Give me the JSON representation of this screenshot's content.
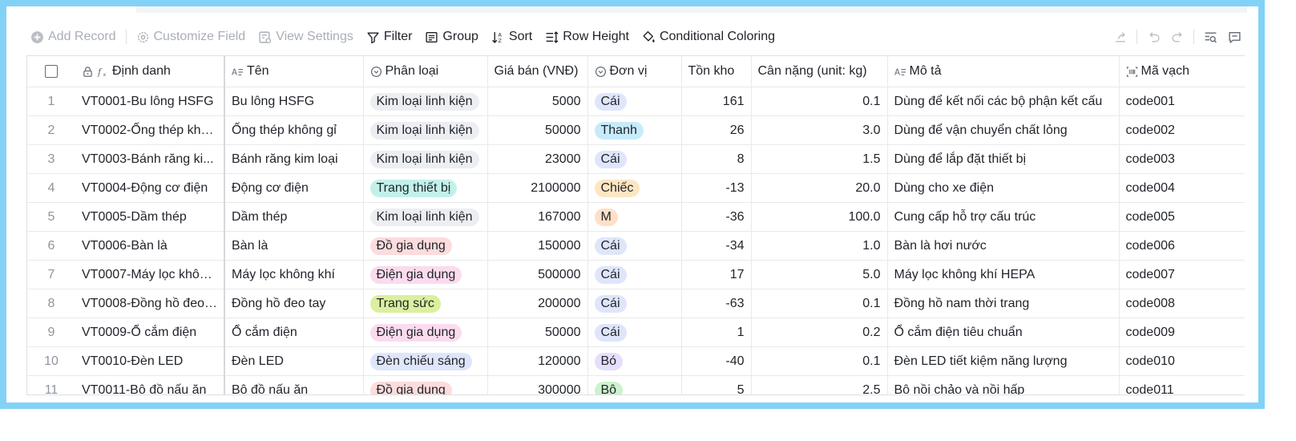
{
  "toolbar": {
    "add_record": "Add Record",
    "customize_field": "Customize Field",
    "view_settings": "View Settings",
    "filter": "Filter",
    "group": "Group",
    "sort": "Sort",
    "row_height": "Row Height",
    "conditional_coloring": "Conditional Coloring"
  },
  "columns": {
    "id": "Định danh",
    "name": "Tên",
    "category": "Phân loại",
    "price": "Giá bán (VNĐ)",
    "unit": "Đơn vị",
    "stock": "Tồn kho",
    "weight": "Cân nặng (unit: kg)",
    "desc": "Mô tả",
    "barcode": "Mã vạch"
  },
  "tag_colors": {
    "Kim loại linh kiện": "#eceef1",
    "Trang thiết bị": "#c2f1ea",
    "Đồ gia dụng": "#fcdcdc",
    "Điện gia dụng": "#fbdbee",
    "Trang sức": "#dbef9e",
    "Đèn chiếu sáng": "#dfe6fb",
    "Cái": "#dfe6fb",
    "Thanh": "#c8ebfa",
    "Chiếc": "#fde6c2",
    "M": "#fde0c8",
    "Bó": "#e6defb",
    "Bộ": "#cdf2cd"
  },
  "rows": [
    {
      "n": "1",
      "id": "VT0001-Bu lông HSFG",
      "name": "Bu lông HSFG",
      "category": "Kim loại linh kiện",
      "price": "5000",
      "unit": "Cái",
      "stock": "161",
      "weight": "0.1",
      "desc": "Dùng để kết nối các bộ phận kết cấu",
      "barcode": "code001"
    },
    {
      "n": "2",
      "id": "VT0002-Ống thép khô...",
      "name": "Ống thép không gỉ",
      "category": "Kim loại linh kiện",
      "price": "50000",
      "unit": "Thanh",
      "stock": "26",
      "weight": "3.0",
      "desc": "Dùng để vận chuyển chất lỏng",
      "barcode": "code002"
    },
    {
      "n": "3",
      "id": "VT0003-Bánh răng ki...",
      "name": "Bánh răng kim loại",
      "category": "Kim loại linh kiện",
      "price": "23000",
      "unit": "Cái",
      "stock": "8",
      "weight": "1.5",
      "desc": "Dùng để lắp đặt thiết bị",
      "barcode": "code003"
    },
    {
      "n": "4",
      "id": "VT0004-Động cơ điện",
      "name": "Động cơ điện",
      "category": "Trang thiết bị",
      "price": "2100000",
      "unit": "Chiếc",
      "stock": "-13",
      "weight": "20.0",
      "desc": "Dùng cho xe điện",
      "barcode": "code004"
    },
    {
      "n": "5",
      "id": "VT0005-Dầm thép",
      "name": "Dầm thép",
      "category": "Kim loại linh kiện",
      "price": "167000",
      "unit": "M",
      "stock": "-36",
      "weight": "100.0",
      "desc": "Cung cấp hỗ trợ cấu trúc",
      "barcode": "code005"
    },
    {
      "n": "6",
      "id": "VT0006-Bàn là",
      "name": "Bàn là",
      "category": "Đồ gia dụng",
      "price": "150000",
      "unit": "Cái",
      "stock": "-34",
      "weight": "1.0",
      "desc": "Bàn là hơi nước",
      "barcode": "code006"
    },
    {
      "n": "7",
      "id": "VT0007-Máy lọc không...",
      "name": "Máy lọc không khí",
      "category": "Điện gia dụng",
      "price": "500000",
      "unit": "Cái",
      "stock": "17",
      "weight": "5.0",
      "desc": "Máy lọc không khí HEPA",
      "barcode": "code007"
    },
    {
      "n": "8",
      "id": "VT0008-Đồng hồ đeo ...",
      "name": "Đồng hồ đeo tay",
      "category": "Trang sức",
      "price": "200000",
      "unit": "Cái",
      "stock": "-63",
      "weight": "0.1",
      "desc": "Đồng hồ nam thời trang",
      "barcode": "code008"
    },
    {
      "n": "9",
      "id": "VT0009-Ổ cắm điện",
      "name": "Ổ cắm điện",
      "category": "Điện gia dụng",
      "price": "50000",
      "unit": "Cái",
      "stock": "1",
      "weight": "0.2",
      "desc": "Ổ cắm điện tiêu chuẩn",
      "barcode": "code009"
    },
    {
      "n": "10",
      "id": "VT0010-Đèn LED",
      "name": "Đèn LED",
      "category": "Đèn chiếu sáng",
      "price": "120000",
      "unit": "Bó",
      "stock": "-40",
      "weight": "0.1",
      "desc": "Đèn LED tiết kiệm năng lượng",
      "barcode": "code010"
    },
    {
      "n": "11",
      "id": "VT0011-Bộ đồ nấu ăn",
      "name": "Bộ đồ nấu ăn",
      "category": "Đồ gia dụng",
      "price": "300000",
      "unit": "Bộ",
      "stock": "5",
      "weight": "2.5",
      "desc": "Bộ nồi chảo và nồi hấp",
      "barcode": "code011"
    }
  ]
}
